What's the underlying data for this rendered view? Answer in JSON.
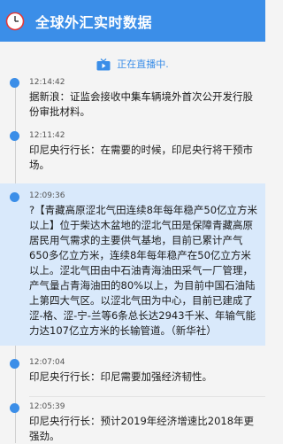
{
  "header": {
    "title": "全球外汇实时数据",
    "icon": "clock-icon"
  },
  "live": {
    "label": "正在直播中.",
    "icon": "tv-icon"
  },
  "colors": {
    "accent": "#3b8ee8",
    "highlight_bg": "#d9e9fb"
  },
  "news": [
    {
      "time": "12:14:42",
      "text": "据新浪：证监会接收中集车辆境外首次公开发行股份审批材料。"
    },
    {
      "time": "12:11:42",
      "text": "印尼央行行长：在需要的时候，印尼央行将干预市场。"
    },
    {
      "time": "12:09:36",
      "text": "?【青藏高原涩北气田连续8年每年稳产50亿立方米以上】位于柴达木盆地的涩北气田是保障青藏高原居民用气需求的主要供气基地，目前已累计产气650多亿立方米，连续8年每年稳产在50亿立方米以上。涩北气田由中石油青海油田采气一厂管理，产气量占青海油田的80%以上，为目前中国石油陆上第四大气区。以涩北气田为中心，目前已建成了涩-格、涩-宁-兰等6条总长达2943千米、年输气能力达107亿立方米的长输管道。（新华社）"
    },
    {
      "time": "12:07:04",
      "text": "印尼央行行长：印尼需要加强经济韧性。"
    },
    {
      "time": "12:05:39",
      "text": "印尼央行行长：预计2019年经济增速比2018年更强劲。"
    }
  ]
}
